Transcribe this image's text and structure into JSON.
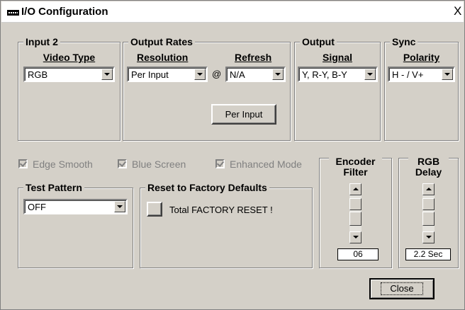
{
  "window": {
    "title": "I/O Configuration",
    "close_label": "X"
  },
  "input": {
    "legend": "Input 2",
    "video_type_label": "Video Type",
    "video_type_value": "RGB"
  },
  "output_rates": {
    "legend": "Output Rates",
    "resolution_label": "Resolution",
    "refresh_label": "Refresh",
    "resolution_value": "Per Input",
    "at_symbol": "@",
    "refresh_value": "N/A",
    "per_input_button": "Per Input"
  },
  "output": {
    "legend": "Output",
    "signal_label": "Signal",
    "signal_value": "Y, R-Y, B-Y"
  },
  "sync": {
    "legend": "Sync",
    "polarity_label": "Polarity",
    "polarity_value": "H - / V+"
  },
  "options": {
    "edge_smooth": {
      "label": "Edge Smooth",
      "checked": true
    },
    "blue_screen": {
      "label": "Blue Screen",
      "checked": true
    },
    "enhanced_mode": {
      "label": "Enhanced Mode",
      "checked": true
    }
  },
  "test_pattern": {
    "legend": "Test Pattern",
    "value": "OFF"
  },
  "reset": {
    "legend": "Reset to Factory Defaults",
    "button_label": "Total FACTORY RESET !"
  },
  "encoder_filter": {
    "line1": "Encoder",
    "line2": "Filter",
    "value": "06"
  },
  "rgb_delay": {
    "line1": "RGB",
    "line2": "Delay",
    "value": "2.2 Sec"
  },
  "close_button": "Close",
  "colors": {
    "face": "#d4d0c8",
    "shadow": "#808080",
    "disabled_text": "#808080"
  }
}
